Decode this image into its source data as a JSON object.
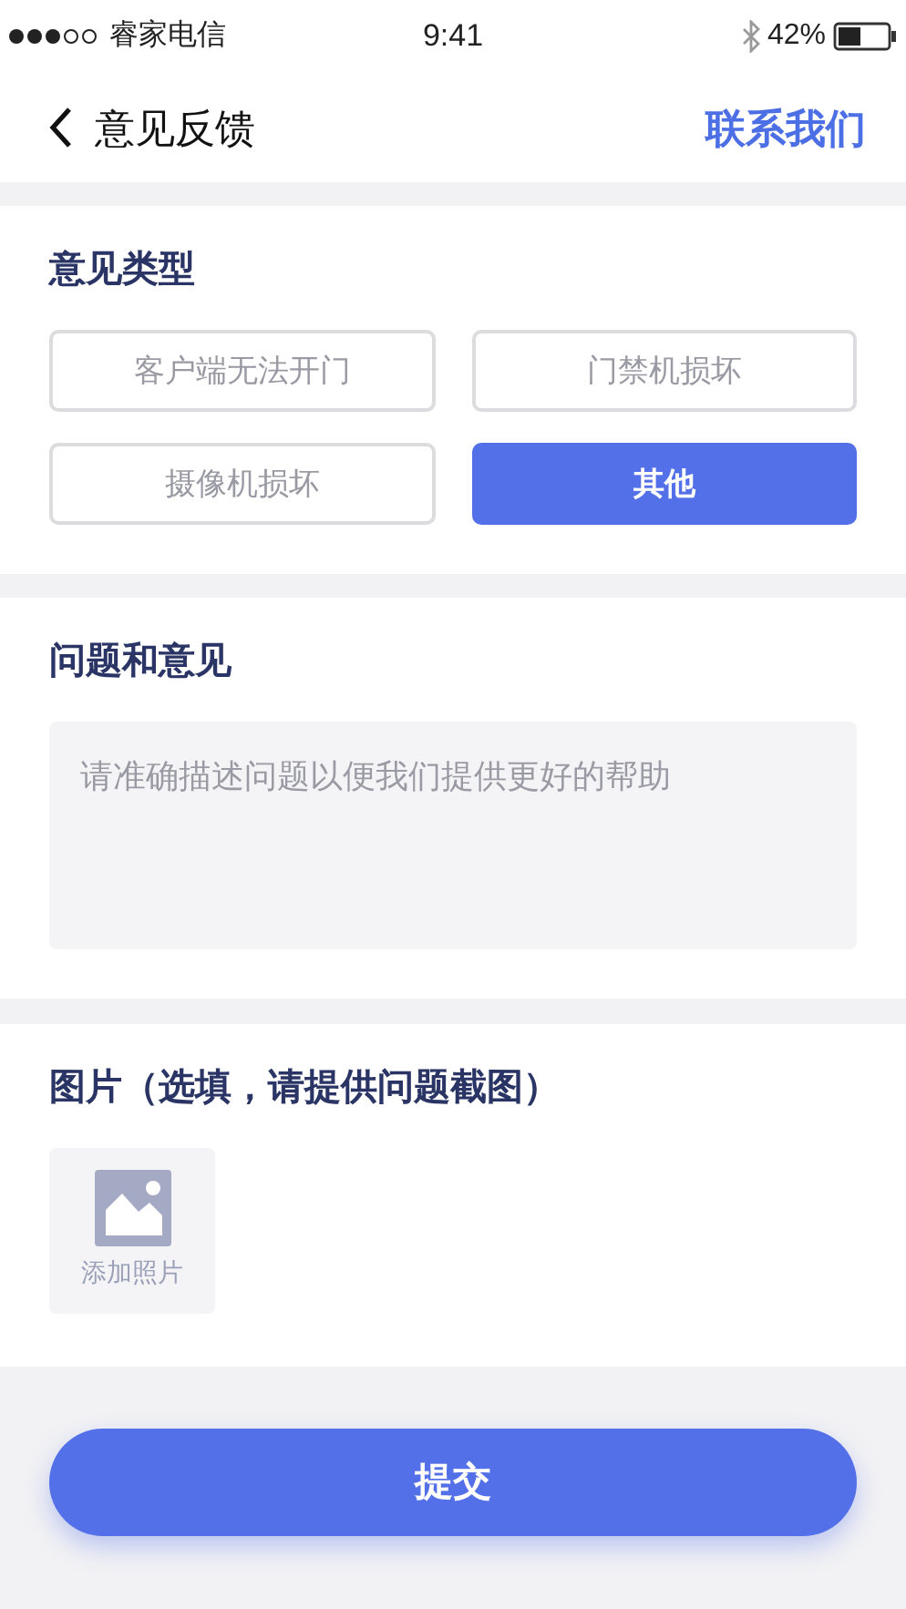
{
  "status_bar": {
    "carrier": "睿家电信",
    "time": "9:41",
    "battery": "42%"
  },
  "nav": {
    "title": "意见反馈",
    "action": "联系我们"
  },
  "feedback_type": {
    "title": "意见类型",
    "options": [
      {
        "label": "客户端无法开门",
        "selected": false
      },
      {
        "label": "门禁机损坏",
        "selected": false
      },
      {
        "label": "摄像机损坏",
        "selected": false
      },
      {
        "label": "其他",
        "selected": true
      }
    ]
  },
  "comments": {
    "title": "问题和意见",
    "placeholder": "请准确描述问题以便我们提供更好的帮助"
  },
  "images": {
    "title": "图片（选填，请提供问题截图）",
    "add_label": "添加照片"
  },
  "submit": "提交"
}
